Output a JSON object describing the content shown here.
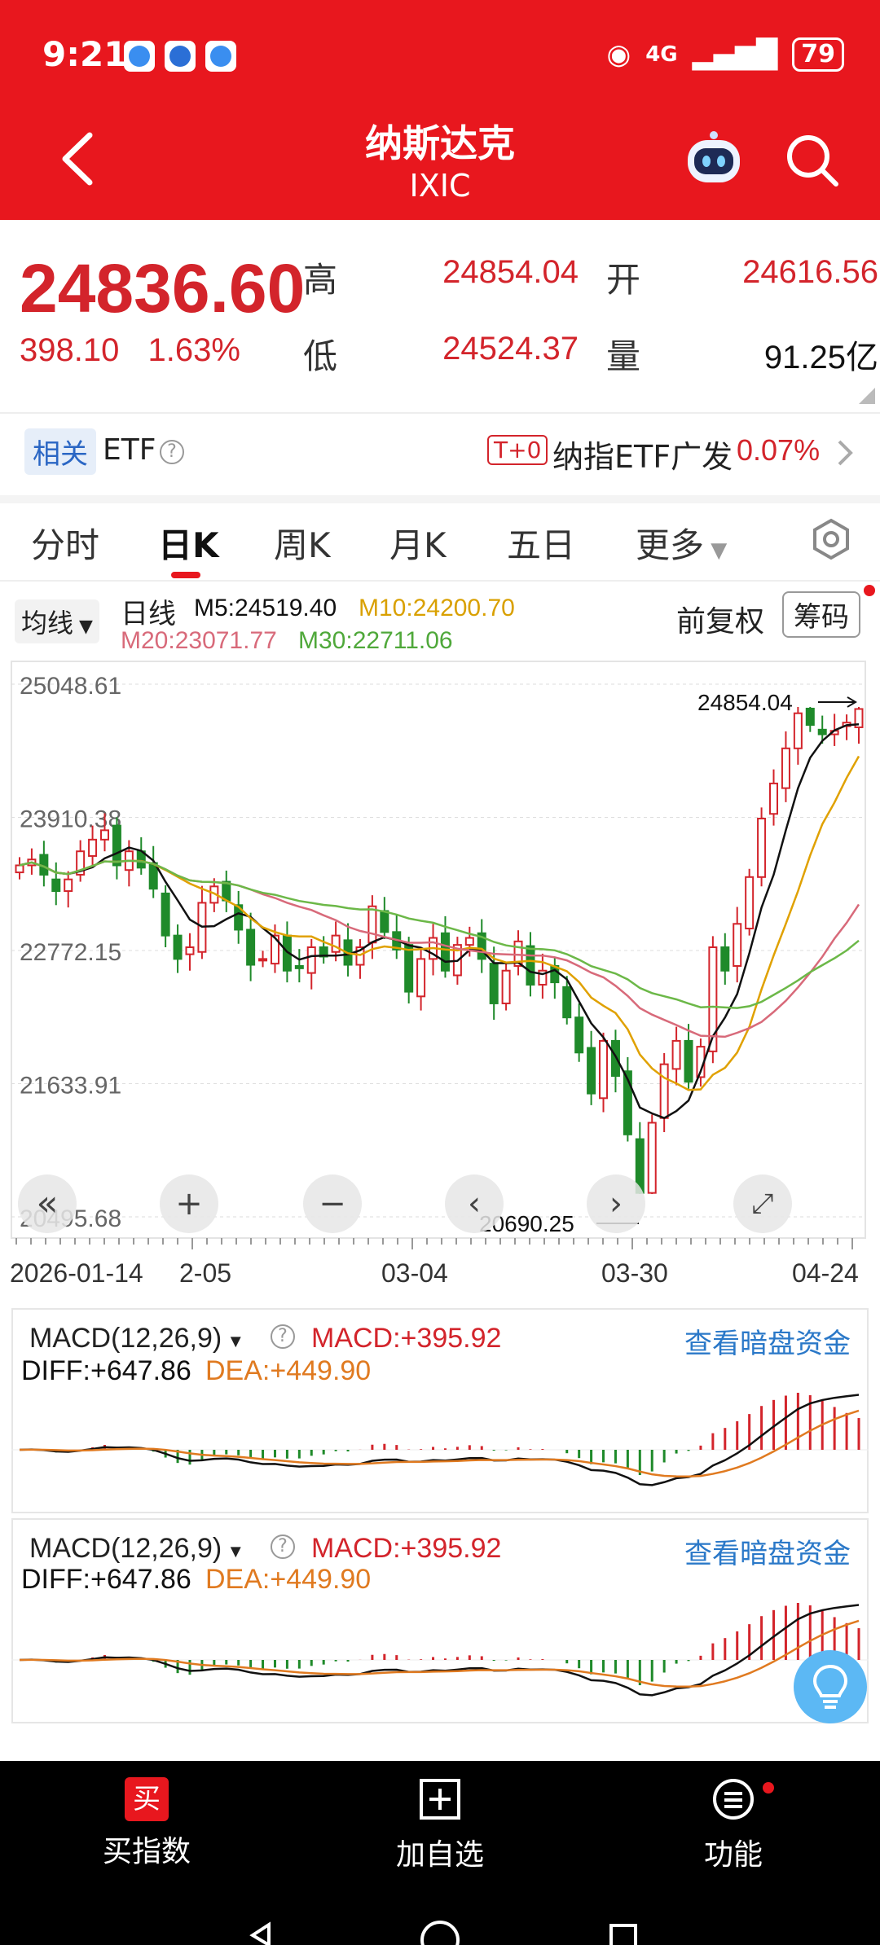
{
  "status": {
    "time": "9:21",
    "network": "4G",
    "battery": "79"
  },
  "header": {
    "title": "纳斯达克",
    "subtitle": "IXIC"
  },
  "quote": {
    "price": "24836.60",
    "change": "398.10",
    "change_pct": "1.63%",
    "high_label": "高",
    "high": "24854.04",
    "open_label": "开",
    "open": "24616.56",
    "low_label": "低",
    "low": "24524.37",
    "volume_label": "量",
    "volume": "91.25亿"
  },
  "etf": {
    "tag": "相关",
    "label": "ETF",
    "badge": "T+0",
    "name": "纳指ETF广发",
    "change": "0.07%"
  },
  "tabs": [
    "分时",
    "日K",
    "周K",
    "月K",
    "五日",
    "更多"
  ],
  "indicators": {
    "selector": "均线",
    "period": "日线",
    "m5": "M5:24519.40",
    "m10": "M10:24200.70",
    "m20": "M20:23071.77",
    "m30": "M30:22711.06",
    "adjust": "前复权",
    "chips": "筹码"
  },
  "chart_labels": {
    "y_ticks": [
      "25048.61",
      "23910.38",
      "22772.15",
      "21633.91",
      "20495.68"
    ],
    "high_marker": "24854.04",
    "low_marker": "20690.25",
    "x_ticks": [
      "2026-01-14",
      "2-05",
      "03-04",
      "03-30",
      "04-24"
    ]
  },
  "macd": {
    "name": "MACD(12,26,9)",
    "macd": "MACD:+395.92",
    "diff": "DIFF:+647.86",
    "dea": "DEA:+449.90",
    "link": "查看暗盘资金"
  },
  "bottom": {
    "buy": "买指数",
    "watch": "加自选",
    "func": "功能"
  },
  "colors": {
    "brand": "#e8171e",
    "up": "#d3242b",
    "down": "#1f8a2a",
    "ma5": "#111111",
    "ma10": "#e0a100",
    "ma20": "#d86a7a",
    "ma30": "#6cb848"
  },
  "chart_data": {
    "type": "candlestick",
    "x": [
      "2026-01-14",
      "2-05",
      "03-04",
      "03-30",
      "04-24"
    ],
    "ylim": [
      20495.68,
      25048.61
    ],
    "y_ticks": [
      25048.61,
      23910.38,
      22772.15,
      21633.91,
      20495.68
    ],
    "high": 24854.04,
    "low": 20690.25,
    "series": [
      {
        "name": "M5",
        "last": 24519.4
      },
      {
        "name": "M10",
        "last": 24200.7
      },
      {
        "name": "M20",
        "last": 23071.77
      },
      {
        "name": "M30",
        "last": 22711.06
      }
    ],
    "close": [
      23500,
      23550,
      23420,
      23280,
      23380,
      23620,
      23720,
      23800,
      23500,
      23620,
      23480,
      23300,
      22900,
      22700,
      22800,
      23180,
      23320,
      23200,
      22950,
      22650,
      22700,
      22900,
      22600,
      22620,
      22800,
      22720,
      22900,
      22650,
      22800,
      23150,
      22930,
      22780,
      22420,
      22700,
      22880,
      22600,
      22820,
      22880,
      22700,
      22320,
      22600,
      22850,
      22480,
      22600,
      22500,
      22200,
      21900,
      21550,
      22000,
      21700,
      21200,
      20700,
      21300,
      21800,
      22000,
      21650,
      21950,
      22800,
      22600,
      23000,
      23400,
      23900,
      24200,
      24500,
      24800,
      24700,
      24620,
      24650,
      24720,
      24836.6
    ]
  }
}
